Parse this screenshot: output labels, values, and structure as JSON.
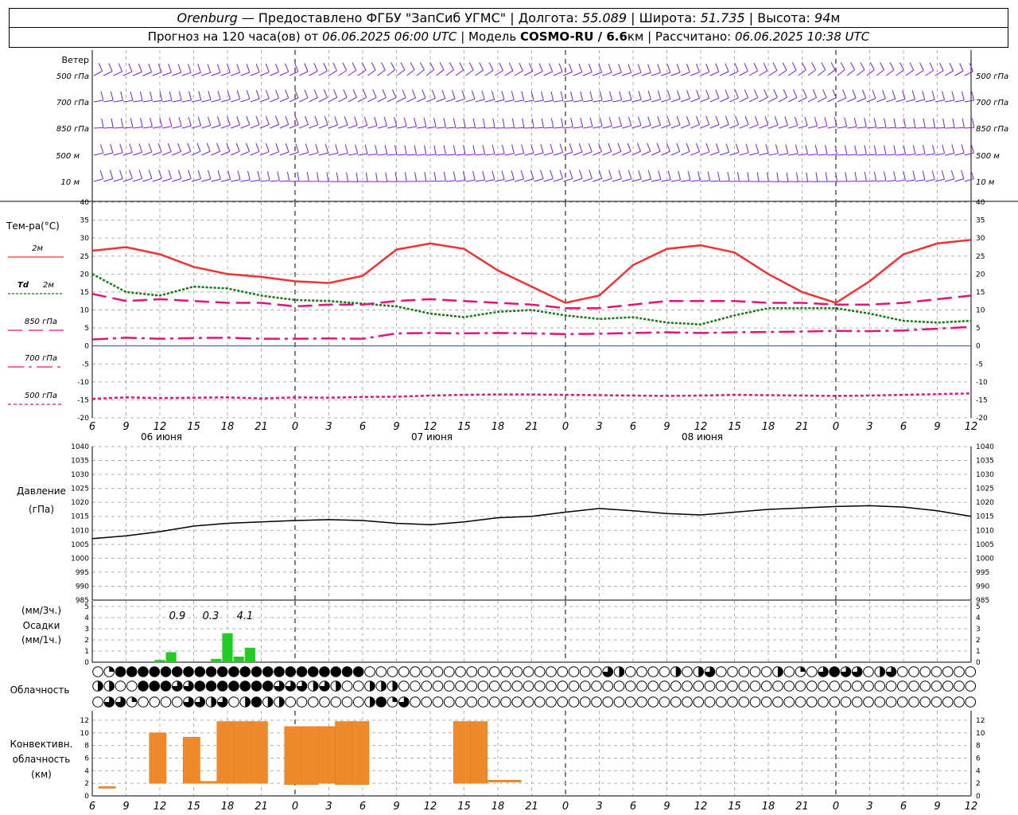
{
  "header": {
    "city": "Orenburg",
    "provider": "— Предоставлено ФГБУ \"ЗапСиб УГМС\" |",
    "lon_label": "Долгота:",
    "lon_value": "55.089",
    "lat_label": "| Широта:",
    "lat_value": "51.735",
    "alt_label": "| Высота:",
    "alt_value": "94",
    "alt_unit": "м",
    "forecast_prefix": "Прогноз на 120 часа(ов) от",
    "forecast_time": "06.06.2025 06:00 UTC",
    "model_label": "| Модель",
    "model_name": "COSMO-RU / 6.6",
    "model_unit": "км",
    "calc_label": "| Рассчитано:",
    "calc_time": "06.06.2025 10:38 UTC"
  },
  "colors": {
    "wind": "#7b1fd6",
    "t2m": "#ee3333",
    "td2m": "#117711",
    "t850": "#e0157a",
    "t700": "#e0157a",
    "t500": "#e0157a",
    "zero_line": "#3344dd",
    "precip": "#22cc22",
    "convective": "#ef8a2c"
  },
  "x_axis": {
    "hour_labels": [
      "6",
      "9",
      "12",
      "15",
      "18",
      "21",
      "0",
      "3",
      "6",
      "9",
      "12",
      "15",
      "18",
      "21",
      "0",
      "3",
      "6",
      "9",
      "12",
      "15",
      "18",
      "21",
      "0",
      "3",
      "6",
      "9",
      "12"
    ],
    "day_labels": [
      "06 июня",
      "07 июня",
      "08 июня"
    ]
  },
  "wind_panel": {
    "title": "Ветер",
    "levels": [
      "500 гПа",
      "700 гПа",
      "850 гПа",
      "500 м",
      "10  м"
    ]
  },
  "temp_panel": {
    "title": "Тем-ра(°C)",
    "legend": [
      {
        "label": "2м",
        "prefix": ""
      },
      {
        "label": "2м",
        "prefix": "Td"
      },
      {
        "label": "850 гПа",
        "prefix": ""
      },
      {
        "label": "700 гПа",
        "prefix": ""
      },
      {
        "label": "500 гПа",
        "prefix": ""
      }
    ],
    "y_ticks": [
      "40",
      "35",
      "30",
      "25",
      "20",
      "15",
      "10",
      "5",
      "0",
      "-5",
      "-10",
      "-15",
      "-20"
    ]
  },
  "pressure_panel": {
    "title_line1": "Давление",
    "title_line2": "(гПа)",
    "y_ticks": [
      "1040",
      "1035",
      "1030",
      "1025",
      "1020",
      "1015",
      "1010",
      "1005",
      "1000",
      "995",
      "990",
      "985"
    ]
  },
  "precip_panel": {
    "title_line1": "(мм/3ч.)",
    "title_line2": "Осадки",
    "title_line3": "(мм/1ч.)",
    "y_ticks": [
      "5",
      "4",
      "3",
      "2",
      "1",
      "0"
    ],
    "totals": [
      "0.9",
      "0.3",
      "4.1"
    ]
  },
  "cloud_panel": {
    "title": "Облачность"
  },
  "conv_panel": {
    "title_line1": "Конвективн.",
    "title_line2": "облачность",
    "title_line3": "(км)",
    "y_ticks": [
      "12",
      "10",
      "8",
      "6",
      "4",
      "2",
      "0"
    ]
  },
  "chart_data": {
    "type": "line",
    "start_time": "06.06.2025 06:00 UTC",
    "x_hours": [
      0,
      3,
      6,
      9,
      12,
      15,
      18,
      21,
      24,
      27,
      30,
      33,
      36,
      39,
      42,
      45,
      48,
      51,
      54,
      57,
      60,
      63,
      66,
      69,
      72,
      75,
      78
    ],
    "series": [
      {
        "name": "2м",
        "values": [
          26.5,
          27.5,
          25.5,
          22,
          20,
          19.2,
          18,
          17.5,
          19.5,
          26.8,
          28.5,
          27,
          21,
          16.5,
          12,
          14,
          22.5,
          27,
          28,
          26,
          20,
          15,
          12,
          18,
          25.5,
          28.5,
          29.5
        ],
        "color": "#ee3333"
      },
      {
        "name": "Td 2м",
        "values": [
          20,
          15,
          14,
          16.5,
          16,
          14,
          12.8,
          12.5,
          11.8,
          11,
          9,
          8,
          9.5,
          10,
          8.5,
          7.5,
          8,
          6.5,
          6,
          8.5,
          10.5,
          10.5,
          10.5,
          9,
          7,
          6.5,
          7
        ],
        "color": "#117711"
      },
      {
        "name": "850 гПа",
        "values": [
          14.5,
          12.5,
          13,
          12.5,
          12,
          12,
          11,
          11.5,
          11.5,
          12.5,
          13,
          12.5,
          12,
          11.5,
          10.5,
          10.5,
          11.5,
          12.5,
          12.5,
          12.5,
          12,
          12,
          11.5,
          11.5,
          12,
          13,
          14
        ],
        "color": "#e0157a"
      },
      {
        "name": "700 гПа",
        "values": [
          1.8,
          2.3,
          2,
          2.2,
          2.3,
          2,
          2,
          2.1,
          2,
          3.5,
          3.6,
          3.5,
          3.6,
          3.5,
          3.3,
          3.4,
          3.6,
          3.8,
          3.6,
          3.8,
          3.9,
          4,
          4.2,
          4.1,
          4.3,
          4.8,
          5.3
        ],
        "color": "#e0157a"
      },
      {
        "name": "500 гПа",
        "values": [
          -14.7,
          -14.3,
          -14.5,
          -14.4,
          -14.3,
          -14.6,
          -14.3,
          -14.4,
          -14.2,
          -14.1,
          -13.8,
          -13.6,
          -13.5,
          -13.5,
          -13.6,
          -13.7,
          -13.8,
          -13.9,
          -13.8,
          -13.6,
          -13.7,
          -13.8,
          -13.9,
          -13.8,
          -13.6,
          -13.4,
          -13.2
        ],
        "color": "#e0157a"
      }
    ],
    "pressure_hpa": [
      1007,
      1008,
      1009.5,
      1011.5,
      1012.5,
      1013,
      1013.5,
      1013.8,
      1013.5,
      1012.5,
      1012,
      1013,
      1014.5,
      1015,
      1016.5,
      1017.8,
      1017,
      1016,
      1015.5,
      1016.5,
      1017.5,
      1018,
      1018.5,
      1018.8,
      1018.3,
      1017,
      1015
    ],
    "precip_hours": [
      6,
      7,
      8,
      9,
      10,
      11,
      12,
      13,
      14,
      15
    ],
    "precip_mm": [
      0.2,
      0.9,
      0,
      0,
      0,
      0.3,
      2.6,
      0.5,
      1.3,
      0
    ],
    "convective_cloud": [
      {
        "hour": 0,
        "base": 1.2,
        "top": 1.5
      },
      {
        "hour": 3,
        "base": 2,
        "top": 10
      },
      {
        "hour": 5,
        "base": 2,
        "top": 9.3
      },
      {
        "hour": 6,
        "base": 2,
        "top": 2.3
      },
      {
        "hour": 7,
        "base": 2,
        "top": 11.8
      },
      {
        "hour": 8,
        "base": 2,
        "top": 11.8
      },
      {
        "hour": 9,
        "base": 2,
        "top": 11.8
      },
      {
        "hour": 11,
        "base": 1.8,
        "top": 11
      },
      {
        "hour": 12,
        "base": 1.8,
        "top": 11
      },
      {
        "hour": 13,
        "base": 2,
        "top": 11
      },
      {
        "hour": 14,
        "base": 1.8,
        "top": 11.8
      },
      {
        "hour": 15,
        "base": 1.8,
        "top": 11.8
      },
      {
        "hour": 21,
        "base": 2,
        "top": 11.8
      },
      {
        "hour": 22,
        "base": 2,
        "top": 11.8
      },
      {
        "hour": 23,
        "base": 2.2,
        "top": 2.5
      },
      {
        "hour": 24,
        "base": 2.2,
        "top": 2.5
      }
    ],
    "cloud_cover_low": [
      "C",
      "Q",
      "F",
      "F",
      "F",
      "F",
      "F",
      "F",
      "F",
      "F",
      "F",
      "F",
      "F",
      "F",
      "F",
      "F",
      "F",
      "F",
      "F",
      "F",
      "F",
      "F",
      "F",
      "F",
      "C",
      "C",
      "C",
      "C",
      "C",
      "C",
      "C",
      "C",
      "C",
      "C",
      "C",
      "C",
      "C",
      "C",
      "C",
      "C",
      "C",
      "C",
      "C",
      "C",
      "C",
      "T",
      "H",
      "C",
      "C",
      "C",
      "C",
      "H",
      "C",
      "H",
      "T",
      "C",
      "C",
      "C",
      "C",
      "C",
      "H",
      "C",
      "Q",
      "C",
      "T",
      "F",
      "T",
      "T",
      "C",
      "H",
      "T",
      "C",
      "C",
      "C",
      "C",
      "C",
      "C",
      "C",
      "C",
      "C",
      "C",
      "C",
      "C",
      "C",
      "C",
      "C",
      "C",
      "C",
      "C",
      "C"
    ],
    "cloud_cover_mid": [
      "H",
      "H",
      "C",
      "C",
      "F",
      "F",
      "F",
      "T",
      "T",
      "F",
      "F",
      "F",
      "F",
      "F",
      "F",
      "F",
      "T",
      "T",
      "T",
      "H",
      "T",
      "H",
      "C",
      "C",
      "H",
      "H",
      "H",
      "C",
      "C",
      "C",
      "C",
      "C",
      "C",
      "C",
      "C",
      "C",
      "C",
      "C",
      "C",
      "C",
      "C",
      "C",
      "C",
      "C",
      "C",
      "C",
      "C",
      "C",
      "C",
      "C",
      "C",
      "C",
      "C",
      "C",
      "C",
      "C",
      "C",
      "C",
      "C",
      "C",
      "C",
      "C",
      "C",
      "C",
      "C",
      "C",
      "C",
      "C",
      "C",
      "C",
      "C",
      "C",
      "C",
      "C",
      "C",
      "C",
      "C",
      "C",
      "C",
      "C",
      "C",
      "C",
      "C",
      "C",
      "C",
      "C",
      "C",
      "C",
      "C",
      "C"
    ],
    "cloud_cover_high": [
      "C",
      "T",
      "T",
      "Q",
      "C",
      "C",
      "C",
      "C",
      "T",
      "T",
      "H",
      "T",
      "C",
      "H",
      "F",
      "H",
      "H",
      "C",
      "C",
      "C",
      "C",
      "C",
      "C",
      "C",
      "H",
      "F",
      "Q",
      "T",
      "C",
      "C",
      "C",
      "C",
      "C",
      "C",
      "C",
      "C",
      "C",
      "C",
      "C",
      "C",
      "C",
      "C",
      "C",
      "C",
      "C",
      "C",
      "C",
      "C",
      "C",
      "C",
      "C",
      "C",
      "C",
      "C",
      "C",
      "C",
      "C",
      "C",
      "C",
      "C",
      "C",
      "C",
      "C",
      "C",
      "C",
      "C",
      "C",
      "C",
      "C",
      "C",
      "C",
      "C",
      "C",
      "C",
      "C",
      "C",
      "C",
      "C",
      "C",
      "C",
      "C",
      "C",
      "C",
      "C",
      "C",
      "C",
      "C",
      "C",
      "C",
      "C"
    ],
    "y_ranges": {
      "temperature": [
        -20,
        40
      ],
      "pressure": [
        985,
        1040
      ],
      "precip": [
        0,
        5
      ],
      "convective_km": [
        0,
        13
      ]
    },
    "grid": true
  }
}
